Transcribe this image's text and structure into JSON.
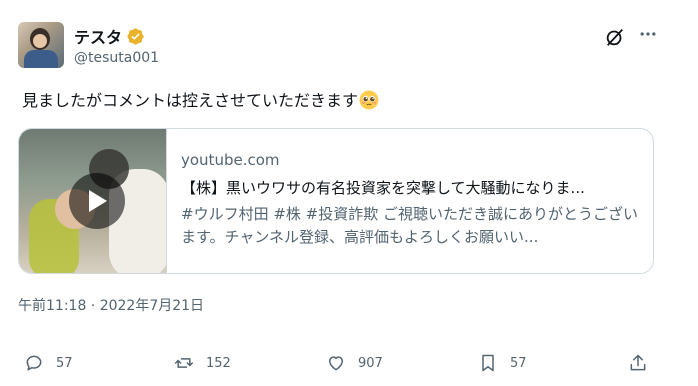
{
  "author": {
    "display_name": "テスタ",
    "handle": "@tesuta001",
    "verified": true,
    "badge_color": "#e8b22a"
  },
  "tweet": {
    "text": "見ましたがコメントは控えさせていただきます"
  },
  "card": {
    "domain": "youtube.com",
    "title": "【株】黒いウワサの有名投資家を突撃して大騒動になりま...",
    "description": "#ウルフ村田 #株 #投資詐欺 ご視聴いただき誠にありがとうございます。チャンネル登録、高評価もよろしくお願いい..."
  },
  "timestamp": "午前11:18 · 2022年7月21日",
  "actions": {
    "replies": "57",
    "reposts": "152",
    "likes": "907",
    "bookmarks": "57"
  },
  "colors": {
    "text_primary": "#0f1419",
    "text_secondary": "#536471",
    "border": "#cfd9de"
  }
}
